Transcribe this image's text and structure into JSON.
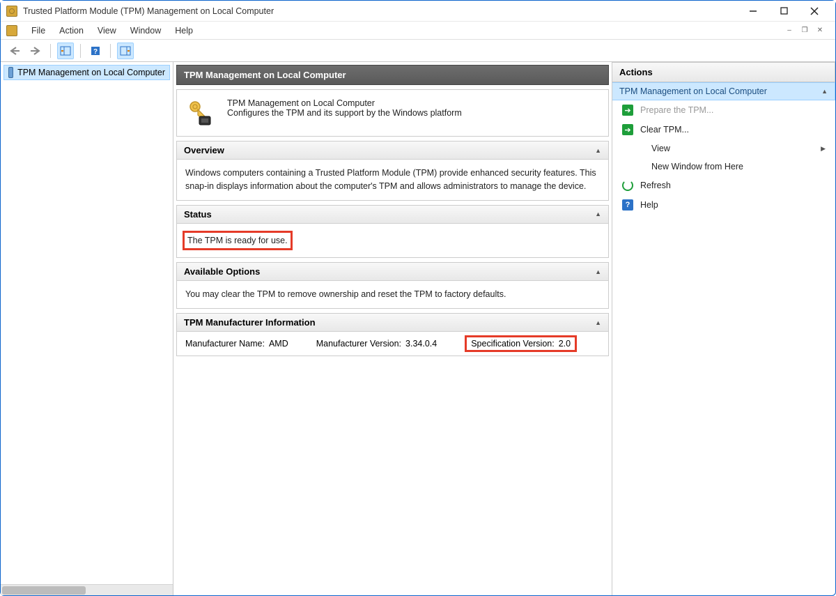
{
  "window": {
    "title": "Trusted Platform Module (TPM) Management on Local Computer"
  },
  "menus": [
    "File",
    "Action",
    "View",
    "Window",
    "Help"
  ],
  "tree": {
    "node": "TPM Management on Local Computer"
  },
  "center": {
    "header": "TPM Management on Local Computer",
    "intro_title": "TPM Management on Local Computer",
    "intro_desc": "Configures the TPM and its support by the Windows platform",
    "overview_head": "Overview",
    "overview_body": "Windows computers containing a Trusted Platform Module (TPM) provide enhanced security features. This snap-in displays information about the computer's TPM and allows administrators to manage the device.",
    "status_head": "Status",
    "status_body": "The TPM is ready for use.",
    "options_head": "Available Options",
    "options_body": "You may clear the TPM to remove ownership and reset the TPM to factory defaults.",
    "manuf_head": "TPM Manufacturer Information",
    "manuf_name_label": "Manufacturer Name:",
    "manuf_name_value": "AMD",
    "manuf_ver_label": "Manufacturer Version:",
    "manuf_ver_value": "3.34.0.4",
    "spec_ver_label": "Specification Version:",
    "spec_ver_value": "2.0"
  },
  "actions": {
    "panel_title": "Actions",
    "group_title": "TPM Management on Local Computer",
    "items": [
      {
        "label": "Prepare the TPM...",
        "icon": "green",
        "disabled": true
      },
      {
        "label": "Clear TPM...",
        "icon": "green"
      },
      {
        "label": "View",
        "icon": "none",
        "arrow": true,
        "indent": true
      },
      {
        "label": "New Window from Here",
        "icon": "none",
        "indent": true
      },
      {
        "label": "Refresh",
        "icon": "refresh"
      },
      {
        "label": "Help",
        "icon": "help"
      }
    ]
  }
}
